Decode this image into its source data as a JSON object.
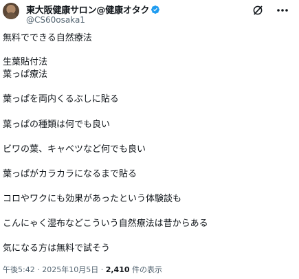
{
  "post": {
    "author": {
      "display_name": "東大阪健康サロン@健康オタク",
      "handle": "@CS60osaka1"
    },
    "lines": [
      "無料でできる自然療法",
      "生葉貼付法",
      "葉っぱ療法",
      "葉っぱを両内くるぶしに貼る",
      "葉っぱの種類は何でも良い",
      "ビワの葉、キャベツなど何でも良い",
      "葉っぱがカラカラになるまで貼る",
      "コロやワクにも効果があったという体験談も",
      "こんにゃく湿布などこういう自然療法は昔からある",
      "気になる方は無料で試そう"
    ],
    "footer": {
      "time": "午後5:42",
      "separator": "·",
      "date": "2025年10月5日",
      "views": "2,410",
      "views_label": "件の表示"
    }
  },
  "icons": {
    "verified": "verified-badge-icon",
    "grok": "grok-icon",
    "more": "more-options-icon"
  },
  "colors": {
    "text": "#0f1419",
    "secondary": "#536471",
    "verified": "#1d9bf0"
  }
}
